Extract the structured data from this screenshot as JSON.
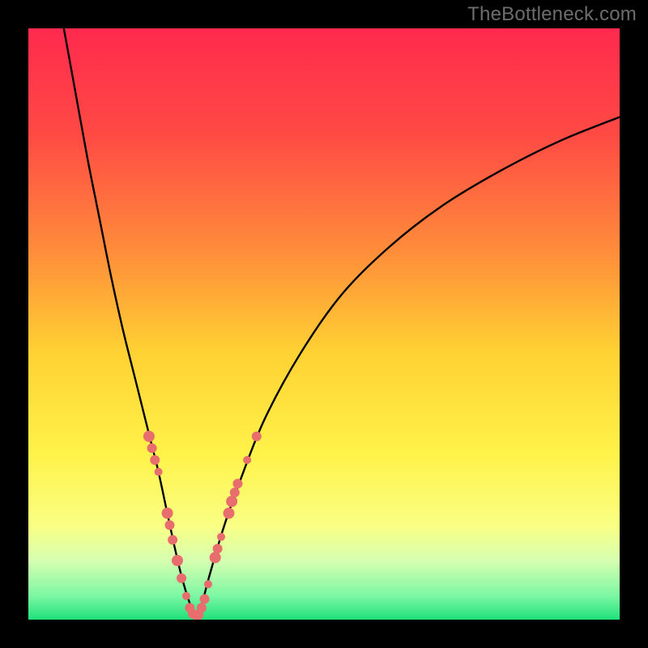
{
  "watermark": "TheBottleneck.com",
  "chart_data": {
    "type": "line",
    "title": "",
    "xlabel": "",
    "ylabel": "",
    "xlim": [
      0,
      100
    ],
    "ylim": [
      0,
      100
    ],
    "gradient_stops": [
      {
        "offset": 0.0,
        "color": "#ff2a4e"
      },
      {
        "offset": 0.18,
        "color": "#ff4a44"
      },
      {
        "offset": 0.38,
        "color": "#ff8e3a"
      },
      {
        "offset": 0.55,
        "color": "#ffd233"
      },
      {
        "offset": 0.72,
        "color": "#fff249"
      },
      {
        "offset": 0.84,
        "color": "#faff83"
      },
      {
        "offset": 0.9,
        "color": "#d6ffb0"
      },
      {
        "offset": 0.96,
        "color": "#7cf7a3"
      },
      {
        "offset": 1.0,
        "color": "#1fe07a"
      }
    ],
    "series": [
      {
        "name": "left-branch",
        "x": [
          6.0,
          8.0,
          10.0,
          12.0,
          14.0,
          16.0,
          18.0,
          20.5,
          22.0,
          23.5,
          24.8,
          26.0,
          27.4,
          28.3
        ],
        "y": [
          100.0,
          89.0,
          78.0,
          68.0,
          58.0,
          49.0,
          41.0,
          31.0,
          25.0,
          18.0,
          12.0,
          7.0,
          2.5,
          0.8
        ]
      },
      {
        "name": "right-branch",
        "x": [
          28.3,
          29.3,
          30.5,
          33.0,
          36.0,
          40.0,
          46.0,
          53.0,
          61.0,
          70.0,
          80.0,
          90.0,
          100.0
        ],
        "y": [
          0.8,
          2.5,
          7.0,
          15.5,
          24.0,
          34.0,
          45.0,
          55.0,
          63.0,
          70.0,
          76.0,
          81.0,
          85.0
        ]
      }
    ],
    "scatter": {
      "name": "dots",
      "color": "#e86d6d",
      "points": [
        {
          "x": 20.4,
          "y": 31.0,
          "r": 7
        },
        {
          "x": 20.9,
          "y": 29.0,
          "r": 6
        },
        {
          "x": 21.4,
          "y": 27.0,
          "r": 6
        },
        {
          "x": 22.0,
          "y": 25.0,
          "r": 5
        },
        {
          "x": 23.5,
          "y": 18.0,
          "r": 7
        },
        {
          "x": 23.9,
          "y": 16.0,
          "r": 6
        },
        {
          "x": 24.4,
          "y": 13.5,
          "r": 6
        },
        {
          "x": 25.2,
          "y": 10.0,
          "r": 7
        },
        {
          "x": 25.9,
          "y": 7.0,
          "r": 6
        },
        {
          "x": 26.7,
          "y": 4.0,
          "r": 5
        },
        {
          "x": 27.3,
          "y": 2.0,
          "r": 6
        },
        {
          "x": 27.8,
          "y": 1.0,
          "r": 6
        },
        {
          "x": 28.3,
          "y": 0.8,
          "r": 6
        },
        {
          "x": 28.8,
          "y": 0.8,
          "r": 6
        },
        {
          "x": 29.3,
          "y": 2.0,
          "r": 6
        },
        {
          "x": 29.8,
          "y": 3.5,
          "r": 6
        },
        {
          "x": 30.4,
          "y": 6.0,
          "r": 5
        },
        {
          "x": 31.6,
          "y": 10.5,
          "r": 7
        },
        {
          "x": 32.0,
          "y": 12.0,
          "r": 6
        },
        {
          "x": 32.6,
          "y": 14.0,
          "r": 5
        },
        {
          "x": 33.9,
          "y": 18.0,
          "r": 7
        },
        {
          "x": 34.4,
          "y": 20.0,
          "r": 7
        },
        {
          "x": 34.9,
          "y": 21.5,
          "r": 6
        },
        {
          "x": 35.4,
          "y": 23.0,
          "r": 6
        },
        {
          "x": 37.0,
          "y": 27.0,
          "r": 5
        },
        {
          "x": 38.6,
          "y": 31.0,
          "r": 6
        }
      ]
    }
  }
}
